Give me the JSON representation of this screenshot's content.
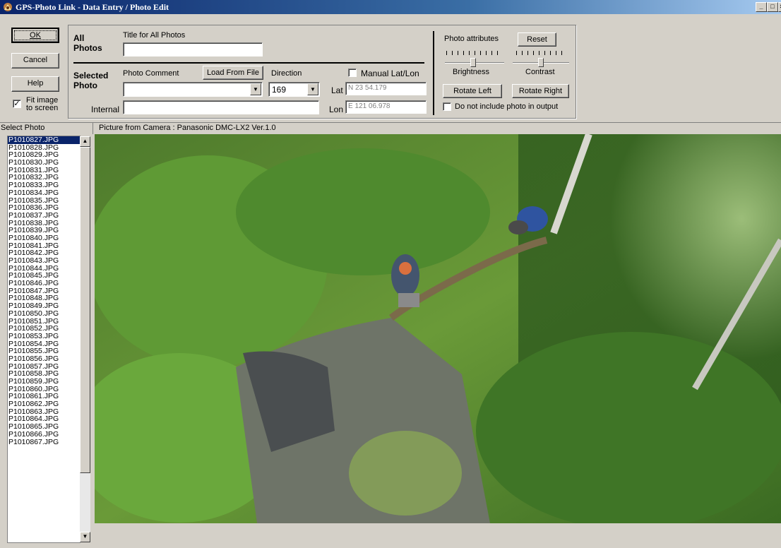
{
  "window": {
    "title": "GPS-Photo Link  - Data Entry / Photo Edit",
    "controls": [
      "_",
      "□",
      "×"
    ]
  },
  "left_buttons": {
    "ok": "OK",
    "cancel": "Cancel",
    "help": "Help",
    "fit_image_line1": "Fit image",
    "fit_image_line2": "to screen",
    "fit_image_checked": true
  },
  "all_photos": {
    "label_line1": "All",
    "label_line2": "Photos",
    "title_label": "Title for All Photos",
    "title_value": ""
  },
  "selected_photo": {
    "label_line1": "Selected",
    "label_line2": "Photo",
    "comment_label": "Photo Comment",
    "comment_value": "",
    "load_button": "Load From File",
    "direction_label": "Direction",
    "direction_value": "169",
    "manual_latlon_label": "Manual Lat/Lon",
    "manual_latlon_checked": false,
    "lat_label": "Lat",
    "lat_value": "N 23 54.179",
    "lon_label": "Lon",
    "lon_value": "E 121 06.978",
    "internal_label": "Internal",
    "internal_value": ""
  },
  "attributes": {
    "label": "Photo attributes",
    "reset": "Reset",
    "brightness_label": "Brightness",
    "brightness_level": 0.5,
    "contrast_label": "Contrast",
    "contrast_level": 0.5,
    "rotate_left": "Rotate Left",
    "rotate_right": "Rotate Right",
    "exclude_label": "Do not include photo in output",
    "exclude_checked": false
  },
  "select_photo_header": "Select Photo",
  "picture_header": "Picture from Camera : Panasonic DMC-LX2 Ver.1.0",
  "photos": {
    "selected": "P1010827.JPG",
    "items": [
      "P1010827.JPG",
      "P1010828.JPG",
      "P1010829.JPG",
      "P1010830.JPG",
      "P1010831.JPG",
      "P1010832.JPG",
      "P1010833.JPG",
      "P1010834.JPG",
      "P1010835.JPG",
      "P1010836.JPG",
      "P1010837.JPG",
      "P1010838.JPG",
      "P1010839.JPG",
      "P1010840.JPG",
      "P1010841.JPG",
      "P1010842.JPG",
      "P1010843.JPG",
      "P1010844.JPG",
      "P1010845.JPG",
      "P1010846.JPG",
      "P1010847.JPG",
      "P1010848.JPG",
      "P1010849.JPG",
      "P1010850.JPG",
      "P1010851.JPG",
      "P1010852.JPG",
      "P1010853.JPG",
      "P1010854.JPG",
      "P1010855.JPG",
      "P1010856.JPG",
      "P1010857.JPG",
      "P1010858.JPG",
      "P1010859.JPG",
      "P1010860.JPG",
      "P1010861.JPG",
      "P1010862.JPG",
      "P1010863.JPG",
      "P1010864.JPG",
      "P1010865.JPG",
      "P1010866.JPG",
      "P1010867.JPG"
    ]
  },
  "colors": {
    "titlebar": "#0a246a",
    "selection": "#0a246a",
    "window_face": "#d4d0c8"
  }
}
